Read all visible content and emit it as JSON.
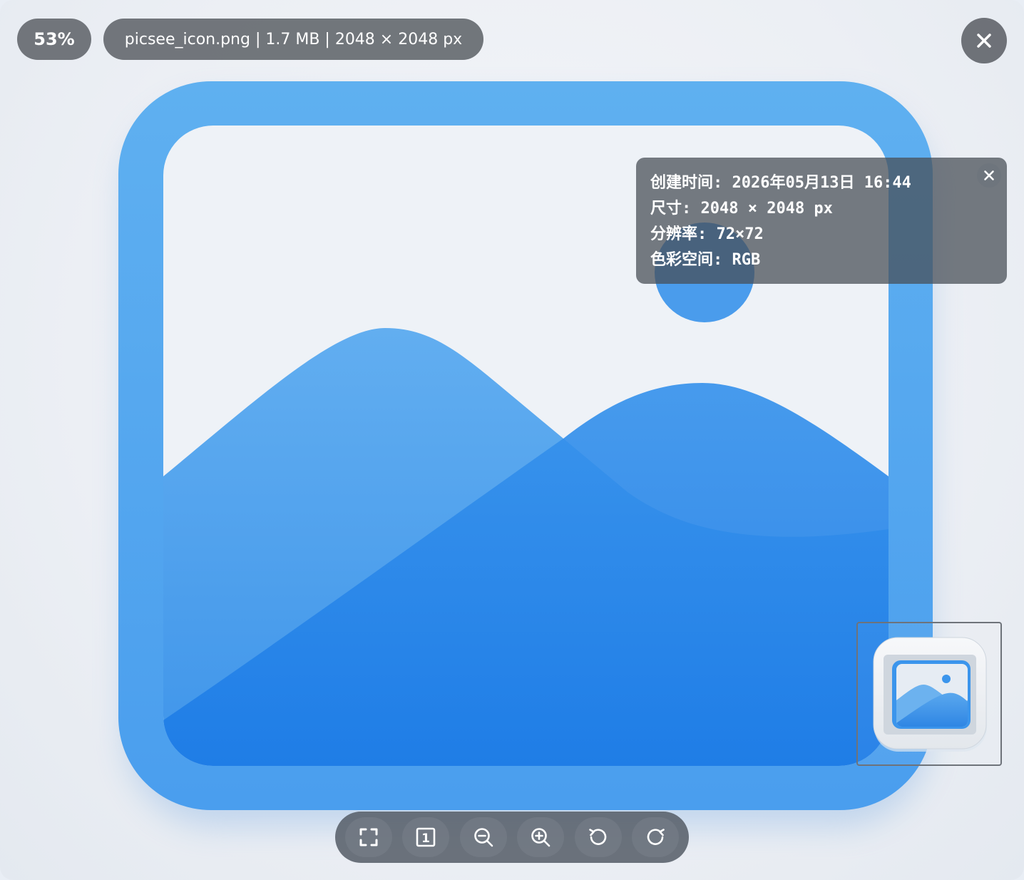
{
  "viewer": {
    "zoom_level": "53%",
    "file_info": "picsee_icon.png | 1.7 MB | 2048 × 2048 px"
  },
  "info_panel": {
    "created": "创建时间: 2026年05月13日 16:44",
    "dimensions": "尺寸: 2048 × 2048 px",
    "resolution": "分辨率: 72×72",
    "color_space": "色彩空间: RGB"
  },
  "toolbar": {
    "buttons": [
      "fit-to-window",
      "actual-size",
      "zoom-out",
      "zoom-in",
      "rotate-left",
      "rotate-right"
    ],
    "actual_size_glyph": "1"
  },
  "icons": {
    "close": "close-icon",
    "info_close": "close-icon",
    "fit": "fullscreen-corners-icon",
    "actual_size": "one-to-one-icon",
    "zoom_out": "zoom-out-icon",
    "zoom_in": "zoom-in-icon",
    "rotate_left": "rotate-left-icon",
    "rotate_right": "rotate-right-icon"
  },
  "colors": {
    "frame_blue": "#5aaaf0",
    "mountain_blue": "#2d8ae8",
    "overlay_gray": "#60646a"
  }
}
